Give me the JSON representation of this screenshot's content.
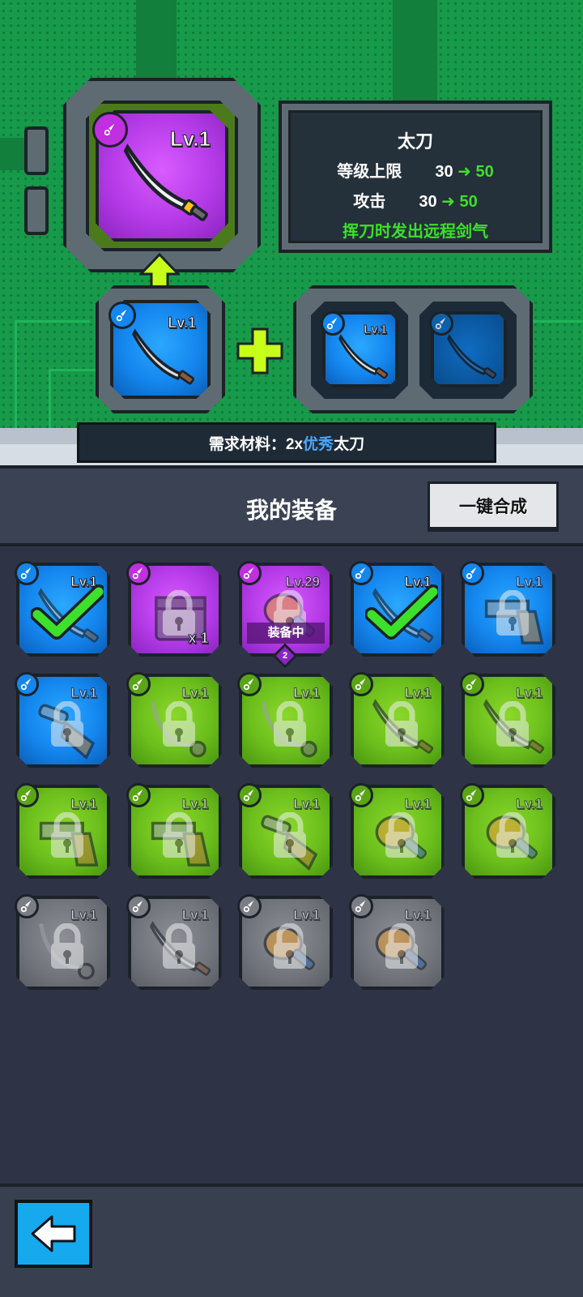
{
  "info": {
    "name": "太刀",
    "level_cap_label": "等级上限",
    "level_cap_from": "30",
    "level_cap_to": "50",
    "attack_label": "攻击",
    "attack_from": "30",
    "attack_to": "50",
    "effect": "挥刀时发出远程剑气"
  },
  "result_item": {
    "level": "Lv.1",
    "rarity": "purple",
    "icon": "katana-icon"
  },
  "base_item": {
    "level": "Lv.1",
    "rarity": "blue",
    "icon": "katana-icon"
  },
  "material_slots": [
    {
      "level": "Lv.1",
      "rarity": "blue",
      "icon": "katana-icon"
    },
    {
      "level": "",
      "rarity": "blue-dim",
      "icon": "katana-icon"
    }
  ],
  "requirement": {
    "prefix": "需求材料：2x",
    "highlight": "优秀",
    "suffix": "太刀",
    "highlight_color": "#4aa8ff"
  },
  "panel": {
    "title": "我的装备",
    "merge_all_button": "一键合成"
  },
  "equipment": [
    {
      "level": "Lv.1",
      "rarity": "blue",
      "icon": "katana-icon",
      "state": "selected"
    },
    {
      "level": "",
      "rarity": "purple",
      "icon": "chest-icon",
      "state": "locked",
      "count": "x 1"
    },
    {
      "level": "Lv.29",
      "rarity": "purple",
      "icon": "club-icon",
      "state": "equipped",
      "equipped_label": "装备中",
      "badge": "2"
    },
    {
      "level": "Lv.1",
      "rarity": "blue",
      "icon": "katana-icon",
      "state": "selected"
    },
    {
      "level": "Lv.1",
      "rarity": "blue",
      "icon": "gun-icon",
      "state": "locked"
    },
    {
      "level": "Lv.1",
      "rarity": "blue",
      "icon": "shotgun-icon",
      "state": "locked"
    },
    {
      "level": "Lv.1",
      "rarity": "green",
      "icon": "chain-icon",
      "state": "locked"
    },
    {
      "level": "Lv.1",
      "rarity": "green",
      "icon": "chain-icon",
      "state": "locked"
    },
    {
      "level": "Lv.1",
      "rarity": "green",
      "icon": "katana-icon",
      "state": "locked"
    },
    {
      "level": "Lv.1",
      "rarity": "green",
      "icon": "katana-icon",
      "state": "locked"
    },
    {
      "level": "Lv.1",
      "rarity": "green",
      "icon": "gun-icon",
      "state": "locked"
    },
    {
      "level": "Lv.1",
      "rarity": "green",
      "icon": "gun-icon",
      "state": "locked"
    },
    {
      "level": "Lv.1",
      "rarity": "green",
      "icon": "shotgun-icon",
      "state": "locked"
    },
    {
      "level": "Lv.1",
      "rarity": "green",
      "icon": "club-icon",
      "state": "locked"
    },
    {
      "level": "Lv.1",
      "rarity": "green",
      "icon": "club-icon",
      "state": "locked"
    },
    {
      "level": "Lv.1",
      "rarity": "gray",
      "icon": "chain-icon",
      "state": "locked"
    },
    {
      "level": "Lv.1",
      "rarity": "gray",
      "icon": "katana-icon",
      "state": "locked"
    },
    {
      "level": "Lv.1",
      "rarity": "gray",
      "icon": "club-icon",
      "state": "locked"
    },
    {
      "level": "Lv.1",
      "rarity": "gray",
      "icon": "club-icon",
      "state": "locked"
    }
  ],
  "colors": {
    "purple": "#b53be8",
    "blue": "#1486ee",
    "green": "#6cbf1c",
    "gray": "#71747b",
    "accent_green": "#3de02a",
    "arrow_yellow": "#c8ff1a"
  }
}
